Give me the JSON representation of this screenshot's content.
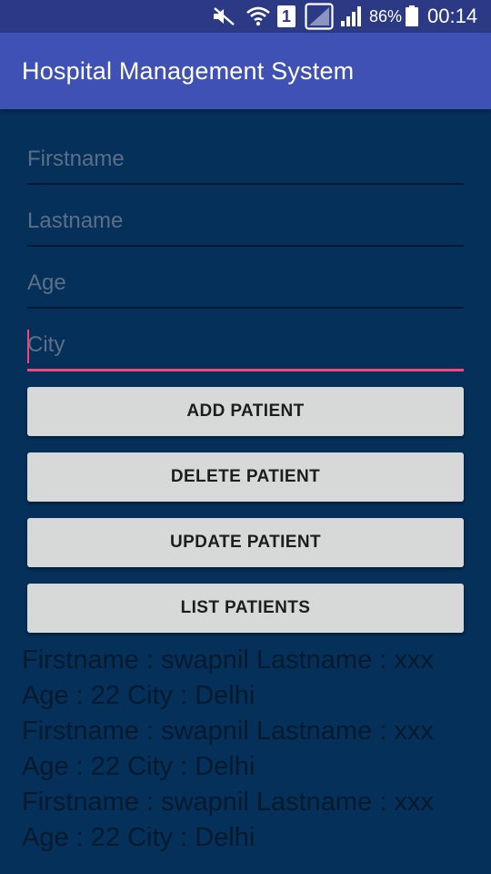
{
  "status_bar": {
    "battery_percent": "86%",
    "time": "00:14",
    "sim_slot": "1",
    "icons": [
      "mute-icon",
      "wifi-icon",
      "sim-icon",
      "no-signal-icon",
      "signal-icon",
      "battery-icon"
    ]
  },
  "app_bar": {
    "title": "Hospital Management System"
  },
  "form": {
    "firstname_placeholder": "Firstname",
    "lastname_placeholder": "Lastname",
    "age_placeholder": "Age",
    "city_placeholder": "City"
  },
  "buttons": {
    "add": "ADD PATIENT",
    "delete": "DELETE PATIENT",
    "update": "UPDATE PATIENT",
    "list": "LIST PATIENTS"
  },
  "output": {
    "entries": [
      "Firstname : swapnil Lastname : xxx Age : 22 City : Delhi",
      "Firstname : swapnil Lastname : xxx Age : 22 City : Delhi",
      "Firstname : swapnil Lastname : xxx Age : 22 City : Delhi"
    ]
  },
  "colors": {
    "background": "#05305a",
    "app_bar": "#3f51b5",
    "status_bar": "#2c3a86",
    "accent": "#f5457a",
    "button": "#d7d9d8"
  }
}
